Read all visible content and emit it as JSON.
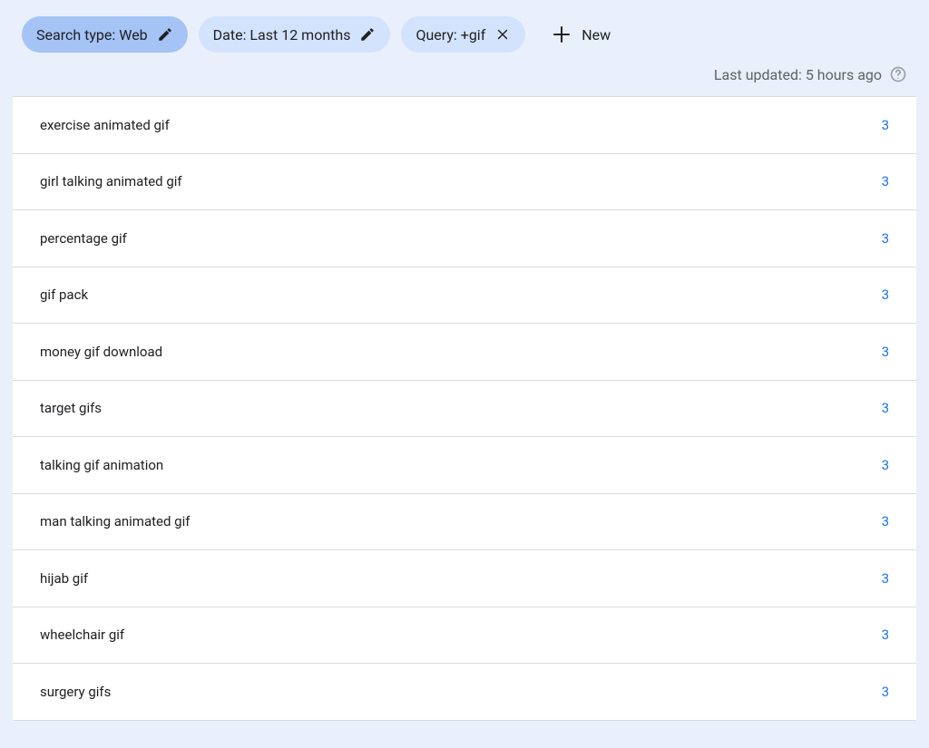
{
  "filters": {
    "search_type": {
      "label": "Search type: Web"
    },
    "date": {
      "label": "Date: Last 12 months"
    },
    "query": {
      "label": "Query: +gif"
    },
    "new_button": {
      "label": "New"
    }
  },
  "status": {
    "last_updated": "Last updated: 5 hours ago"
  },
  "rows": [
    {
      "label": "exercise animated gif",
      "value": "3"
    },
    {
      "label": "girl talking animated gif",
      "value": "3"
    },
    {
      "label": "percentage gif",
      "value": "3"
    },
    {
      "label": "gif pack",
      "value": "3"
    },
    {
      "label": "money gif download",
      "value": "3"
    },
    {
      "label": "target gifs",
      "value": "3"
    },
    {
      "label": "talking gif animation",
      "value": "3"
    },
    {
      "label": "man talking animated gif",
      "value": "3"
    },
    {
      "label": "hijab gif",
      "value": "3"
    },
    {
      "label": "wheelchair gif",
      "value": "3"
    },
    {
      "label": "surgery gifs",
      "value": "3"
    }
  ]
}
